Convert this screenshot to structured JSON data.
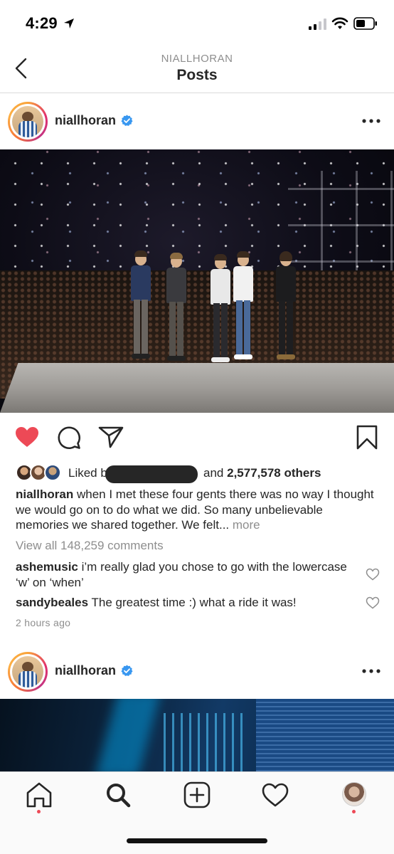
{
  "status_bar": {
    "time": "4:29"
  },
  "nav": {
    "subtitle": "NIALLHORAN",
    "title": "Posts"
  },
  "post1": {
    "username": "niallhoran",
    "liked_prefix": "Liked b",
    "liked_suffix_and": "and",
    "likes_count": "2,577,578 others",
    "caption_username": "niallhoran",
    "caption_text": "when I met these four gents there was no way I thought we would go on to do what we did. So many unbelievable memories we shared together. We felt...",
    "caption_more": "more",
    "view_all": "View all 148,259 comments",
    "comments": [
      {
        "user": "ashemusic",
        "text": "i’m really glad you chose to go with the lowercase ‘w’ on ‘when’"
      },
      {
        "user": "sandybeales",
        "text": "The greatest time :) what a ride it was!"
      }
    ],
    "time_ago": "2 hours ago"
  },
  "post2": {
    "username": "niallhoran"
  },
  "colors": {
    "accent_like": "#ed4956",
    "verified": "#3897f0",
    "muted": "#8e8e8e",
    "text": "#262626"
  },
  "icons": [
    "location-arrow-icon",
    "signal-icon",
    "wifi-icon",
    "battery-icon",
    "back-chevron-icon",
    "verified-badge-icon",
    "more-dots-icon",
    "heart-filled-icon",
    "comment-icon",
    "share-icon",
    "bookmark-icon",
    "heart-outline-icon",
    "home-icon",
    "search-icon",
    "add-post-icon",
    "activity-heart-icon"
  ]
}
